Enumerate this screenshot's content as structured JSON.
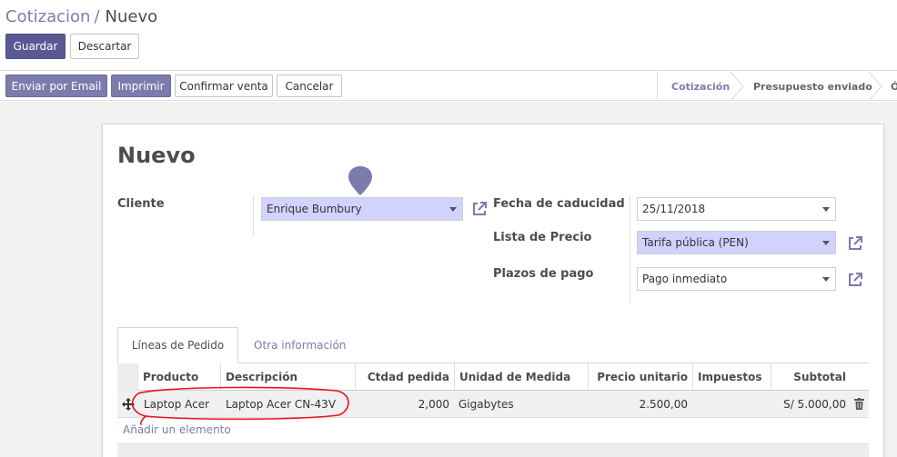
{
  "breadcrumb": {
    "parent": "Cotizacion",
    "current": "Nuevo"
  },
  "toolbar": {
    "save_label": "Guardar",
    "discard_label": "Descartar"
  },
  "actions": {
    "send_email_label": "Enviar por Email",
    "print_label": "Imprimir",
    "confirm_label": "Confirmar venta",
    "cancel_label": "Cancelar"
  },
  "statusbar": {
    "steps": [
      "Cotización",
      "Presupuesto enviado",
      "Ó"
    ],
    "active_index": 0
  },
  "form": {
    "title": "Nuevo",
    "client_label": "Cliente",
    "client_value": "Enrique Bumbury",
    "expiry_label": "Fecha de caducidad",
    "expiry_value": "25/11/2018",
    "pricelist_label": "Lista de Precio",
    "pricelist_value": "Tarifa pública (PEN)",
    "payment_terms_label": "Plazos de pago",
    "payment_terms_value": "Pago inmediato"
  },
  "tabs": [
    {
      "label": "Líneas de Pedido",
      "active": true
    },
    {
      "label": "Otra información",
      "active": false
    }
  ],
  "order_lines": {
    "columns": [
      "Producto",
      "Descripción",
      "Ctdad pedida",
      "Unidad de Medida",
      "Precio unitario",
      "Impuestos",
      "Subtotal"
    ],
    "rows": [
      {
        "product": "Laptop Acer",
        "description": "Laptop Acer CN-43V",
        "quantity": "2,000",
        "uom": "Gigabytes",
        "unit_price": "2.500,00",
        "taxes": "",
        "subtotal": "S/ 5.000,00"
      }
    ],
    "add_line_label": "Añadir un elemento"
  },
  "icons": {
    "external_link": "external-link-icon",
    "drag_handle": "drag-handle-icon",
    "delete": "trash-icon",
    "pin": "map-pin-icon"
  },
  "colors": {
    "brand": "#7c7bad",
    "required_field": "#d2d2ff",
    "annotation": "#e8141b"
  }
}
